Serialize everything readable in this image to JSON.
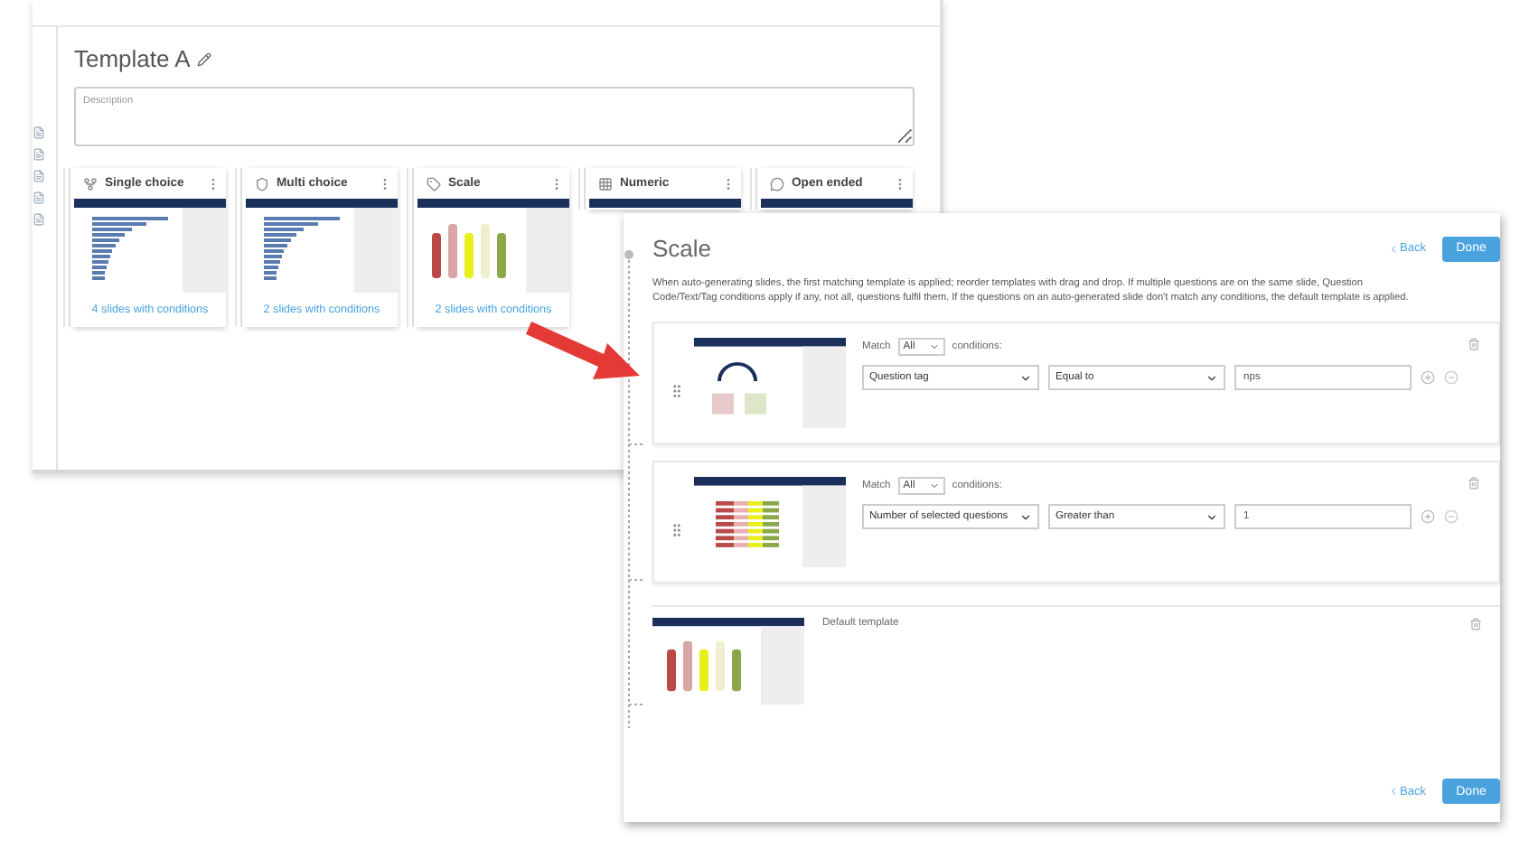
{
  "back_window": {
    "title": "Template A",
    "description_placeholder": "Description",
    "question_types": [
      {
        "label": "Single choice",
        "footer": "4 slides with conditions"
      },
      {
        "label": "Multi choice",
        "footer": "2 slides with conditions"
      },
      {
        "label": "Scale",
        "footer": "2 slides with conditions"
      },
      {
        "label": "Numeric"
      },
      {
        "label": "Open ended"
      }
    ]
  },
  "panel": {
    "title": "Scale",
    "back": "Back",
    "done": "Done",
    "description": "When auto-generating slides, the first matching template is applied; reorder templates with drag and drop. If multiple questions are on the same slide, Question Code/Text/Tag conditions apply if any, not all, questions fulfil them. If the questions on an auto-generated slide don't match any conditions, the default template is applied.",
    "rules": [
      {
        "match_label": "Match",
        "match": "All",
        "conditions_label": "conditions:",
        "field": "Question tag",
        "operator": "Equal to",
        "value": "nps"
      },
      {
        "match_label": "Match",
        "match": "All",
        "conditions_label": "conditions:",
        "field": "Number of selected questions",
        "operator": "Greater than",
        "value": "1"
      }
    ],
    "default_template": "Default template",
    "footer_back": "Back",
    "footer_done": "Done"
  }
}
